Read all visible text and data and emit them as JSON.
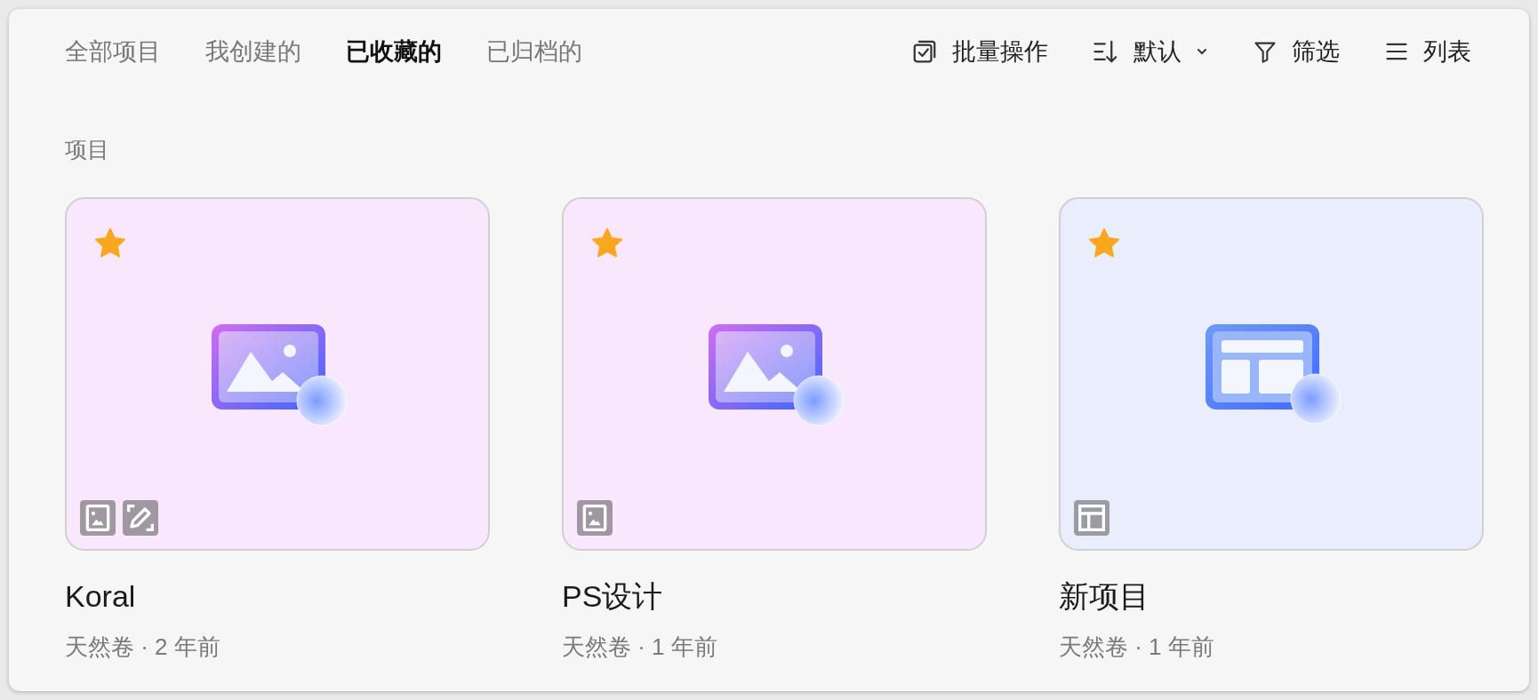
{
  "tabs": [
    {
      "label": "全部项目",
      "selected": false
    },
    {
      "label": "我创建的",
      "selected": false
    },
    {
      "label": "已收藏的",
      "selected": true
    },
    {
      "label": "已归档的",
      "selected": false
    }
  ],
  "toolbar": [
    {
      "kind": "batch",
      "label": "批量操作"
    },
    {
      "kind": "sort",
      "label": "默认"
    },
    {
      "kind": "filter",
      "label": "筛选"
    },
    {
      "kind": "list",
      "label": "列表"
    }
  ],
  "section_title": "项目",
  "projects": [
    {
      "name": "Koral",
      "meta": "天然卷 · 2 年前",
      "kind": "image",
      "starred": true,
      "badges": [
        {
          "kind": "image"
        },
        {
          "kind": "edit"
        }
      ]
    },
    {
      "name": "PS设计",
      "meta": "天然卷 · 1 年前",
      "kind": "image",
      "starred": true,
      "badges": [
        {
          "kind": "image"
        }
      ]
    },
    {
      "name": "新项目",
      "meta": "天然卷 · 1 年前",
      "kind": "layout",
      "starred": true,
      "badges": [
        {
          "kind": "layout"
        }
      ]
    }
  ]
}
